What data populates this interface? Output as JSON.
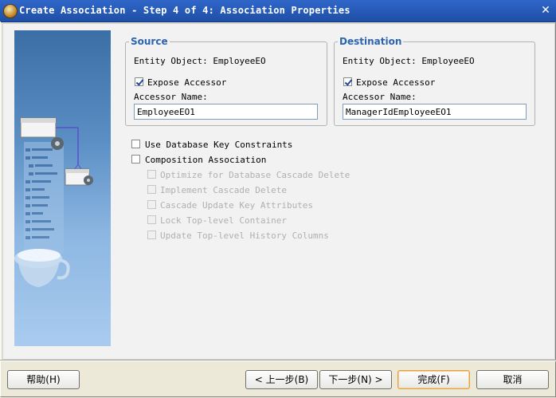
{
  "window": {
    "title": "Create Association - Step 4 of 4: Association Properties",
    "close_glyph": "✕"
  },
  "source": {
    "legend": "Source",
    "entity_label": "Entity Object: EmployeeEO",
    "expose_label": "Expose Accessor",
    "expose_checked": true,
    "accessor_name_label": "Accessor Name:",
    "accessor_name_value": "EmployeeEO1"
  },
  "destination": {
    "legend": "Destination",
    "entity_label": "Entity Object: EmployeeEO",
    "expose_label": "Expose Accessor",
    "expose_checked": true,
    "accessor_name_label": "Accessor Name:",
    "accessor_name_value": "ManagerIdEmployeeEO1"
  },
  "options": {
    "use_db_key_constraints": "Use Database Key Constraints",
    "composition_association": "Composition Association",
    "optimize_cascade_delete": "Optimize for Database Cascade Delete",
    "implement_cascade_delete": "Implement Cascade Delete",
    "cascade_update_keys": "Cascade Update Key Attributes",
    "lock_top_level": "Lock Top-level Container",
    "update_history_columns": "Update Top-level History Columns"
  },
  "buttons": {
    "help": "帮助(H)",
    "back": "< 上一步(B)",
    "next": "下一步(N) >",
    "finish": "完成(F)",
    "cancel": "取消"
  },
  "icons": {
    "window": "wizard-coffee-icon",
    "close": "close-icon",
    "side": "wizard-side-illustration"
  }
}
